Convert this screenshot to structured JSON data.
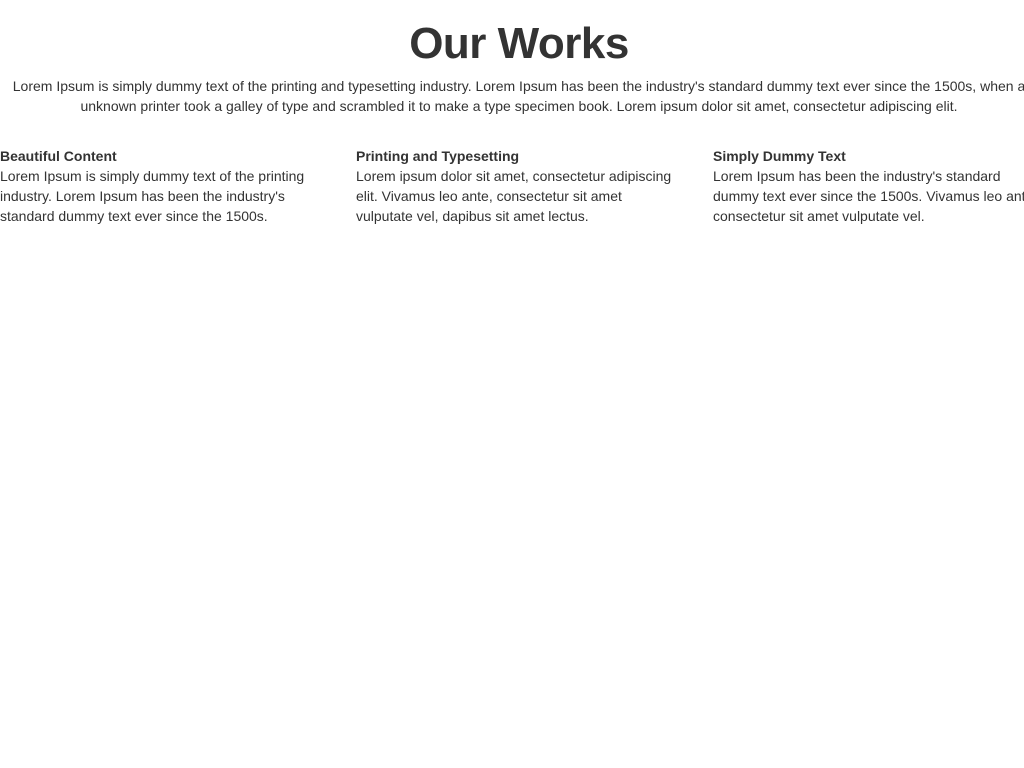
{
  "header": {
    "title": "Our Works",
    "intro_lines": [
      "Lorem Ipsum is simply dummy text of the printing and typesetting industry. Lorem Ipsum has been the industry's standard dummy text ever since the 1500s, when a",
      "unknown printer took a galley of type and scrambled it to make a type specimen book. Lorem ipsum dolor sit amet, consectetur adipiscing elit."
    ]
  },
  "features": [
    {
      "title": "Beautiful Content",
      "lines": [
        "Lorem Ipsum is simply dummy text of the printing",
        "industry. Lorem Ipsum has been the industry's",
        "standard dummy text ever since the 1500s."
      ]
    },
    {
      "title": "Printing and Typesetting",
      "lines": [
        "Lorem ipsum dolor sit amet, consectetur adipiscing",
        "elit. Vivamus leo ante, consectetur sit amet",
        "vulputate vel, dapibus sit amet lectus."
      ]
    },
    {
      "title": "Simply Dummy Text",
      "lines": [
        "Lorem Ipsum has been the industry's standard",
        "dummy text ever since the 1500s. Vivamus leo ant",
        "consectetur sit amet vulputate vel."
      ]
    }
  ],
  "colors": {
    "text": "#333333",
    "background": "#ffffff"
  }
}
